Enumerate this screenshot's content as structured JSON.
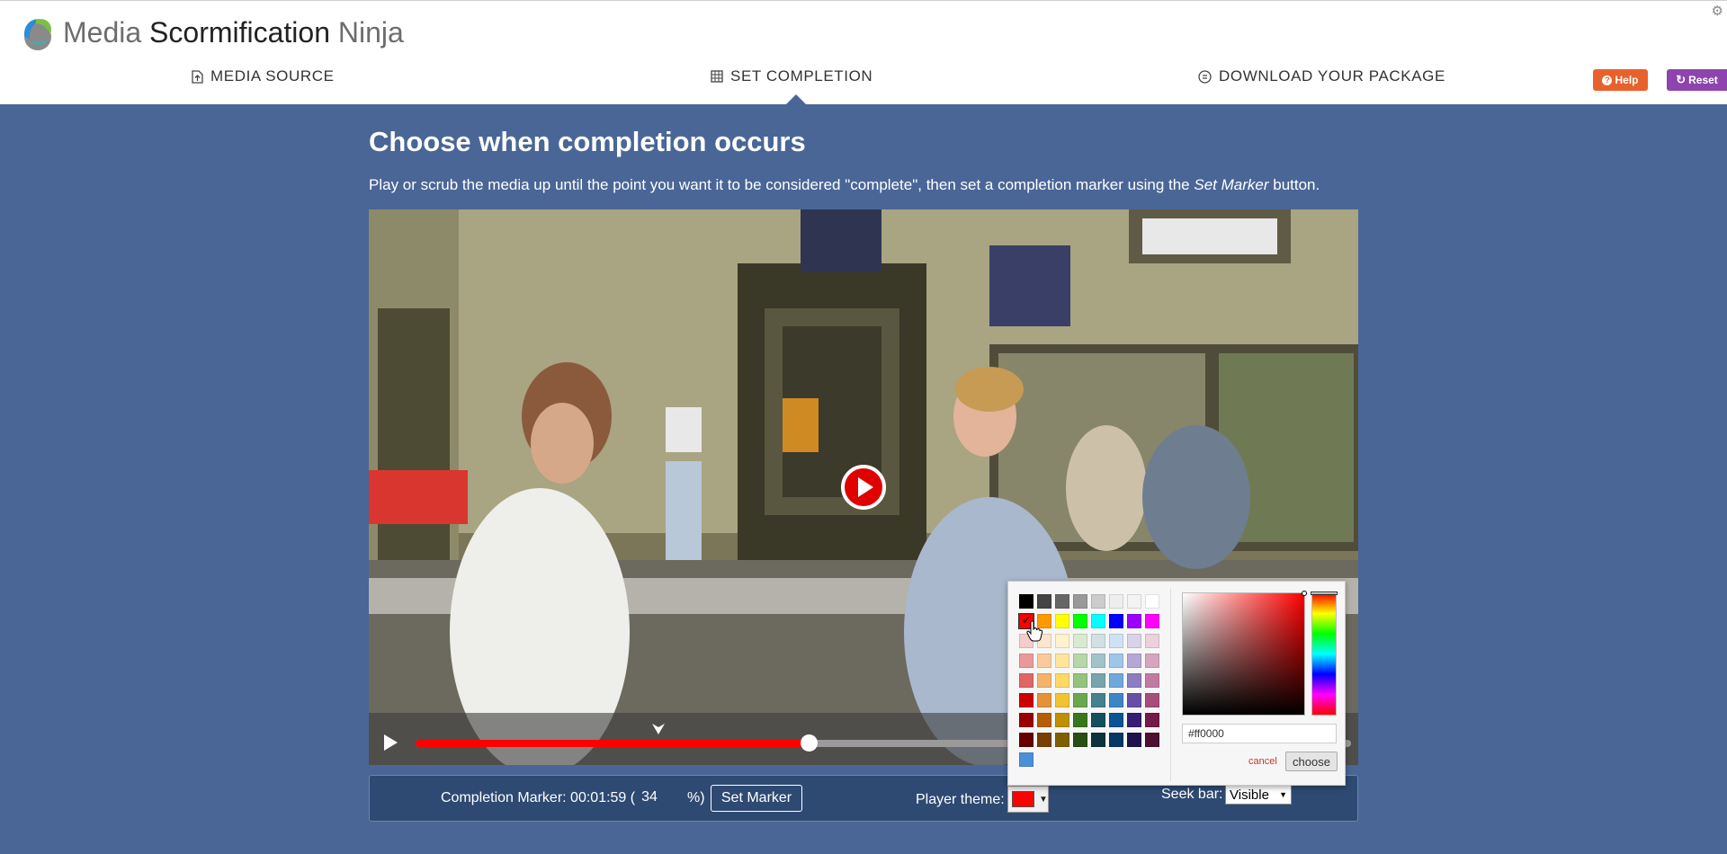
{
  "app": {
    "name_part1": "Media",
    "name_part2": "Scormification",
    "name_part3": "Ninja"
  },
  "nav": {
    "tabs": [
      {
        "label": "MEDIA SOURCE",
        "icon": "upload-icon"
      },
      {
        "label": "SET COMPLETION",
        "icon": "grid-icon",
        "active": true
      },
      {
        "label": "DOWNLOAD YOUR PACKAGE",
        "icon": "download-icon"
      }
    ],
    "help_label": "Help",
    "reset_label": "Reset"
  },
  "main": {
    "title": "Choose when completion occurs",
    "intro_before": "Play or scrub the media up until the point you want it to be considered \"complete\", then set a completion marker using the",
    "intro_em": "Set Marker",
    "intro_after": "button."
  },
  "player": {
    "progress_fraction": 0.42,
    "marker_fraction": 0.26
  },
  "controls": {
    "completion_label": "Completion Marker: 00:01:59 (",
    "percent_value": "34",
    "percent_suffix": "%)",
    "set_marker_label": "Set Marker",
    "theme_label": "Player theme:",
    "theme_color": "#ff0000",
    "seekbar_label": "Seek bar:",
    "seekbar_value": "Visible"
  },
  "picker": {
    "palette": [
      [
        "#000000",
        "#444444",
        "#666666",
        "#999999",
        "#cccccc",
        "#eeeeee",
        "#f3f3f3",
        "#ffffff"
      ],
      [
        "#ff0000",
        "#ff9900",
        "#ffff00",
        "#00ff00",
        "#00ffff",
        "#0000ff",
        "#9900ff",
        "#ff00ff"
      ],
      [
        "#f4cccc",
        "#fce5cd",
        "#fff2cc",
        "#d9ead3",
        "#d0e0e3",
        "#cfe2f3",
        "#d9d2e9",
        "#ead1dc"
      ],
      [
        "#ea9999",
        "#f9cb9c",
        "#ffe599",
        "#b6d7a8",
        "#a2c4c9",
        "#9fc5e8",
        "#b4a7d6",
        "#d5a6bd"
      ],
      [
        "#e06666",
        "#f6b26b",
        "#ffd966",
        "#93c47d",
        "#76a5af",
        "#6fa8dc",
        "#8e7cc3",
        "#c27ba0"
      ],
      [
        "#cc0000",
        "#e69138",
        "#f1c232",
        "#6aa84f",
        "#45818e",
        "#3d85c6",
        "#674ea7",
        "#a64d79"
      ],
      [
        "#990000",
        "#b45f06",
        "#bf9000",
        "#38761d",
        "#134f5c",
        "#0b5394",
        "#351c75",
        "#741b47"
      ],
      [
        "#660000",
        "#783f04",
        "#7f6000",
        "#274e13",
        "#0c343d",
        "#073763",
        "#20124d",
        "#4c1130"
      ],
      [
        "#4a90d9"
      ]
    ],
    "hex_value": "#ff0000",
    "cancel_label": "cancel",
    "choose_label": "choose"
  },
  "colors": {
    "background": "#4a6696",
    "help": "#e8612c",
    "reset": "#8e44ad",
    "accent_red": "#ff0000"
  }
}
